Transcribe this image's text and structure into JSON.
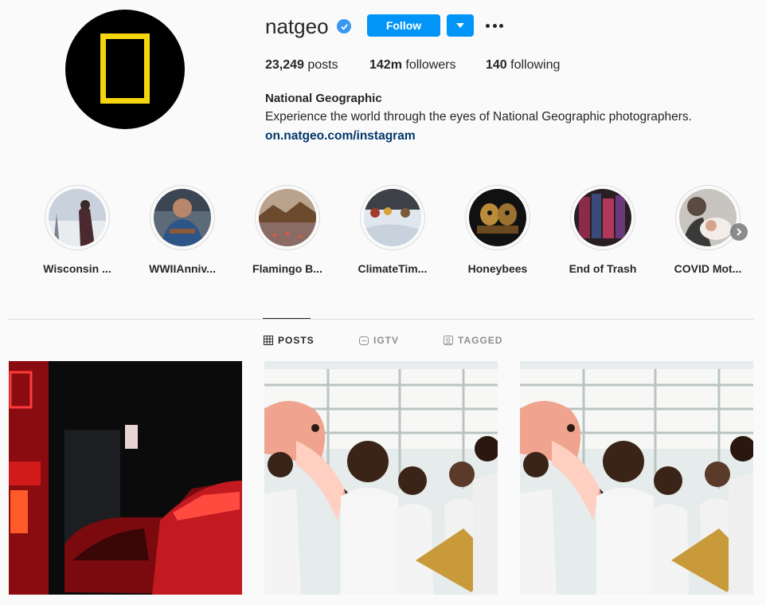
{
  "profile": {
    "username": "natgeo",
    "follow_label": "Follow",
    "posts_count": "23,249",
    "posts_label": " posts",
    "followers_count": "142m",
    "followers_label": " followers",
    "following_count": "140",
    "following_label": " following",
    "full_name": "National Geographic",
    "bio": "Experience the world through the eyes of National Geographic photographers.",
    "link": "on.natgeo.com/instagram"
  },
  "highlights": [
    {
      "label": "Wisconsin ..."
    },
    {
      "label": "WWIIAnniv..."
    },
    {
      "label": "Flamingo B..."
    },
    {
      "label": "ClimateTim..."
    },
    {
      "label": "Honeybees"
    },
    {
      "label": "End of Trash"
    },
    {
      "label": "COVID Mot..."
    }
  ],
  "tabs": [
    {
      "label": "POSTS",
      "icon": "grid-icon",
      "active": true
    },
    {
      "label": "IGTV",
      "icon": "igtv-icon",
      "active": false
    },
    {
      "label": "TAGGED",
      "icon": "tagged-icon",
      "active": false
    }
  ],
  "colors": {
    "accent": "#0095f6",
    "logo_yellow": "#f5d60c",
    "link": "#00376b"
  }
}
